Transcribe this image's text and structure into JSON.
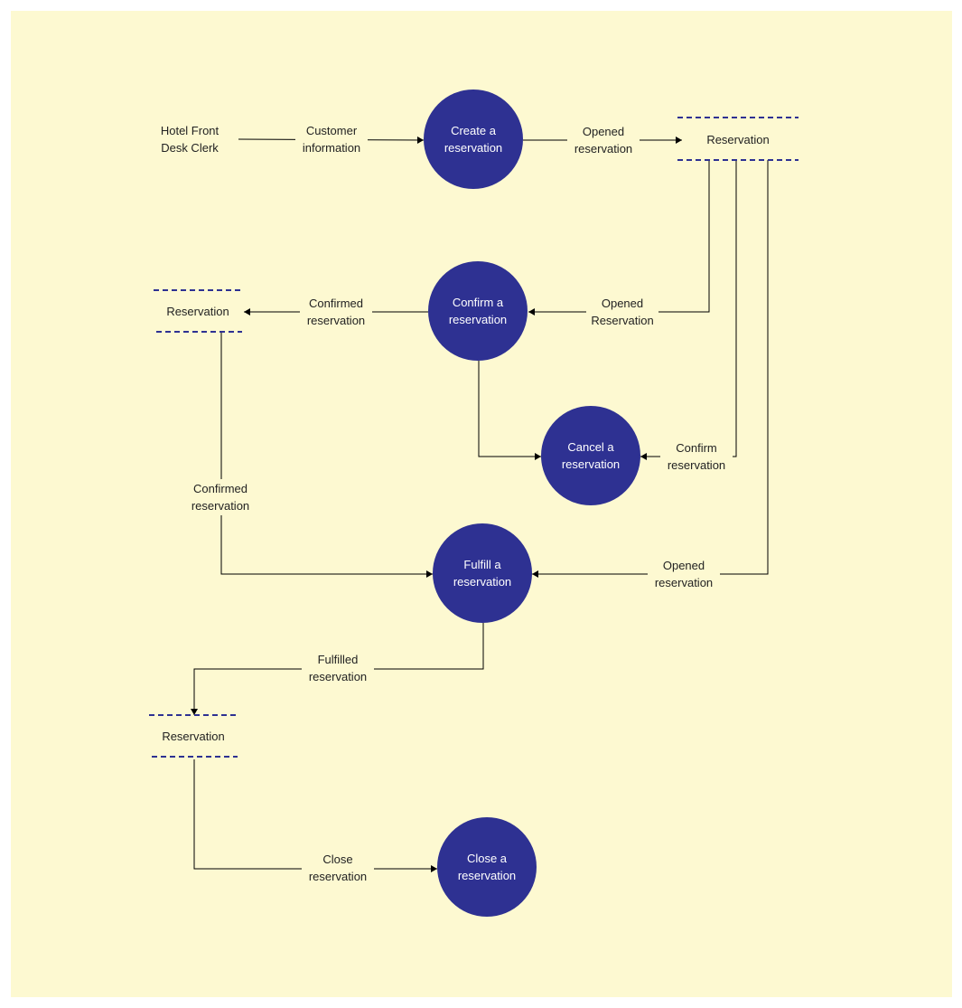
{
  "colors": {
    "canvas": "#fdf9d1",
    "process": "#2e3192",
    "store_line": "#2e3192",
    "line": "#000000"
  },
  "entity": {
    "line1": "Hotel Front",
    "line2": "Desk Clerk"
  },
  "processes": [
    {
      "line1": "Create a",
      "line2": "reservation"
    },
    {
      "line1": "Confirm a",
      "line2": "reservation"
    },
    {
      "line1": "Cancel a",
      "line2": "reservation"
    },
    {
      "line1": "Fulfill a",
      "line2": "reservation"
    },
    {
      "line1": "Close a",
      "line2": "reservation"
    }
  ],
  "stores": [
    {
      "label": "Reservation"
    },
    {
      "label": "Reservation"
    },
    {
      "label": "Reservation"
    }
  ],
  "flows": [
    {
      "line1": "Customer",
      "line2": "information"
    },
    {
      "line1": "Opened",
      "line2": "reservation"
    },
    {
      "line1": "Opened",
      "line2": "Reservation"
    },
    {
      "line1": "Confirm",
      "line2": "reservation"
    },
    {
      "line1": "Opened",
      "line2": "reservation"
    },
    {
      "line1": "Confirmed",
      "line2": "reservation"
    },
    {
      "line1": "Confirmed",
      "line2": "reservation"
    },
    {
      "line1": "Fulfilled",
      "line2": "reservation"
    },
    {
      "line1": "Close",
      "line2": "reservation"
    }
  ]
}
